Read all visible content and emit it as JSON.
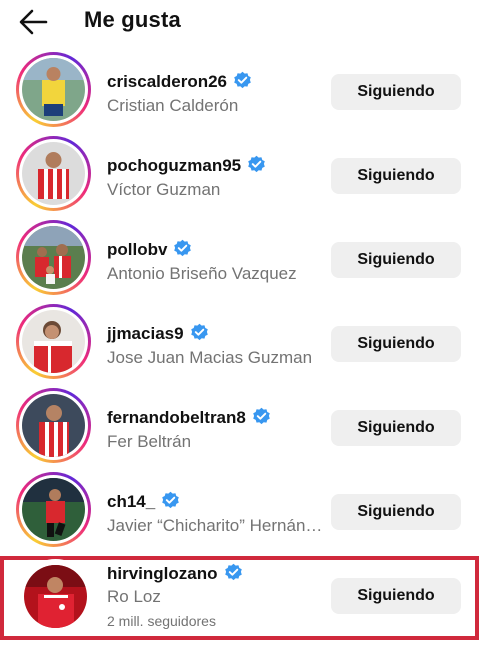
{
  "header": {
    "title": "Me gusta",
    "back_icon": "arrow-left-icon"
  },
  "colors": {
    "verified": "#3897f0",
    "button_bg": "#efefef",
    "highlight_border": "#d0293c",
    "secondary_text": "#737373"
  },
  "users": [
    {
      "username": "criscalderon26",
      "name": "Cristian Calderón",
      "button": "Siguiendo",
      "verified": true
    },
    {
      "username": "pochoguzman95",
      "name": "Víctor Guzman",
      "button": "Siguiendo",
      "verified": true
    },
    {
      "username": "pollobv",
      "name": "Antonio Briseño Vazquez",
      "button": "Siguiendo",
      "verified": true
    },
    {
      "username": "jjmacias9",
      "name": "Jose Juan Macias Guzman",
      "button": "Siguiendo",
      "verified": true
    },
    {
      "username": "fernandobeltran8",
      "name": "Fer Beltrán",
      "button": "Siguiendo",
      "verified": true
    },
    {
      "username": "ch14_",
      "name": "Javier “Chicharito” Hernán…",
      "button": "Siguiendo",
      "verified": true
    },
    {
      "username": "hirvinglozano",
      "name": "Ro Loz",
      "followers": "2 mill. seguidores",
      "button": "Siguiendo",
      "verified": true,
      "highlighted": true
    }
  ]
}
